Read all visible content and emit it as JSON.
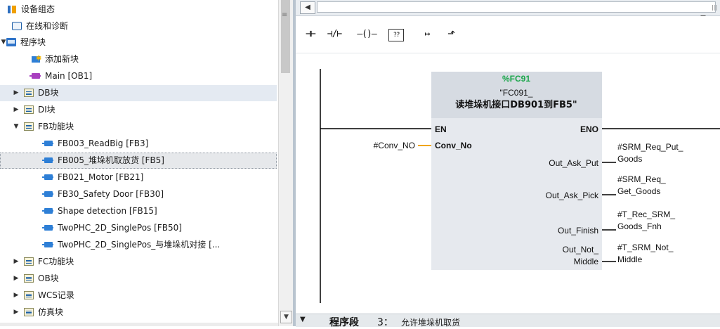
{
  "tree": {
    "items": [
      {
        "label": "设备组态",
        "icon": "device-config-icon",
        "expanded": null
      },
      {
        "label": "在线和诊断",
        "icon": "online-diagnostics-icon",
        "expanded": null
      },
      {
        "label": "程序块",
        "icon": "program-blocks-icon",
        "expanded": true
      },
      {
        "label": "添加新块",
        "icon": "add-block-icon",
        "expanded": null
      },
      {
        "label": "Main [OB1]",
        "icon": "ob-block-icon",
        "expanded": null
      },
      {
        "label": "DB块",
        "icon": "folder-icon",
        "expanded": false
      },
      {
        "label": "DI块",
        "icon": "folder-icon",
        "expanded": false
      },
      {
        "label": "FB功能块",
        "icon": "folder-icon",
        "expanded": true
      },
      {
        "label": "FB003_ReadBig [FB3]",
        "icon": "fb-block-icon",
        "expanded": null
      },
      {
        "label": "FB005_堆垛机取放货 [FB5]",
        "icon": "fb-block-icon",
        "expanded": null
      },
      {
        "label": "FB021_Motor [FB21]",
        "icon": "fb-block-icon",
        "expanded": null
      },
      {
        "label": "FB30_Safety Door [FB30]",
        "icon": "fb-block-icon",
        "expanded": null
      },
      {
        "label": "Shape detection [FB15]",
        "icon": "fb-block-icon",
        "expanded": null
      },
      {
        "label": "TwoPHC_2D_SinglePos [FB50]",
        "icon": "fb-block-icon",
        "expanded": null
      },
      {
        "label": "TwoPHC_2D_SinglePos_与堆垛机对接 [...",
        "icon": "fb-block-icon",
        "expanded": null
      },
      {
        "label": "FC功能块",
        "icon": "folder-icon",
        "expanded": false
      },
      {
        "label": "OB块",
        "icon": "folder-icon",
        "expanded": false
      },
      {
        "label": "WCS记录",
        "icon": "folder-icon",
        "expanded": false
      },
      {
        "label": "仿真块",
        "icon": "folder-icon",
        "expanded": false
      }
    ]
  },
  "toolbar": {
    "buttons": [
      {
        "name": "no-contact-button",
        "symbol": "⊣⊢"
      },
      {
        "name": "nc-contact-button",
        "symbol": "⊣/⊢"
      },
      {
        "name": "coil-button",
        "symbol": "–()–"
      },
      {
        "name": "empty-box-button",
        "symbol": "??"
      },
      {
        "name": "open-branch-button",
        "symbol": "↦"
      },
      {
        "name": "close-branch-button",
        "symbol": "⬏"
      }
    ]
  },
  "block": {
    "address": "%FC91",
    "name_line1": "\"FC091_",
    "name_line2": "读堆垛机接口DB901到FB5\"",
    "en": "EN",
    "eno": "ENO",
    "inputs": [
      {
        "pin": "Conv_No",
        "operand": "#Conv_NO"
      }
    ],
    "outputs": [
      {
        "pin": [
          "Out_Ask_Put"
        ],
        "operand": [
          "#SRM_Req_Put_",
          "Goods"
        ]
      },
      {
        "pin": [
          "Out_Ask_Pick"
        ],
        "operand": [
          "#SRM_Req_",
          "Get_Goods"
        ]
      },
      {
        "pin": [
          "Out_Finish"
        ],
        "operand": [
          "#T_Rec_SRM_",
          "Goods_Fnh"
        ]
      },
      {
        "pin": [
          "Out_Not_",
          "Middle"
        ],
        "operand": [
          "#T_SRM_Not_",
          "Middle"
        ]
      }
    ]
  },
  "network": {
    "label": "程序段",
    "number": "3：",
    "comment": "允许堆垛机取货"
  },
  "colors": {
    "block_header": "#d6dbe2",
    "block_body": "#e6e9ee",
    "block_address": "#1aa64a",
    "wire_orange": "#f0a500",
    "tree_highlight": "#e4eaf2"
  }
}
